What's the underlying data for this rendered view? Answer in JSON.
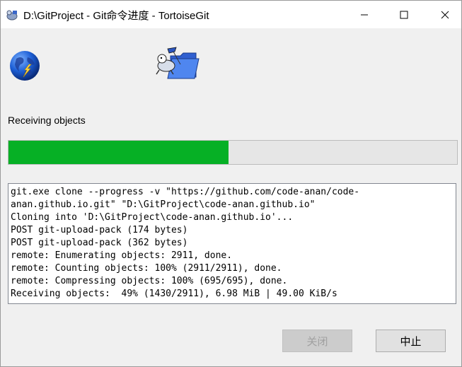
{
  "window": {
    "title": "D:\\GitProject - Git命令进度 - TortoiseGit"
  },
  "status": {
    "label": "Receiving objects",
    "progress_fraction": 0.49
  },
  "log": {
    "lines": [
      "git.exe clone --progress -v \"https://github.com/code-anan/code-",
      "anan.github.io.git\" \"D:\\GitProject\\code-anan.github.io\"",
      "Cloning into 'D:\\GitProject\\code-anan.github.io'...",
      "POST git-upload-pack (174 bytes)",
      "POST git-upload-pack (362 bytes)",
      "remote: Enumerating objects: 2911, done.",
      "remote: Counting objects: 100% (2911/2911), done.",
      "remote: Compressing objects: 100% (695/695), done.",
      "Receiving objects:  49% (1430/2911), 6.98 MiB | 49.00 KiB/s"
    ]
  },
  "buttons": {
    "close_label": "关闭",
    "abort_label": "中止"
  },
  "icons": {
    "app": "tortoisegit-icon",
    "globe": "globe-icon",
    "folder": "tortoise-folder-icon"
  },
  "colors": {
    "progress_fill": "#06b025",
    "progress_track": "#e6e6e6"
  }
}
